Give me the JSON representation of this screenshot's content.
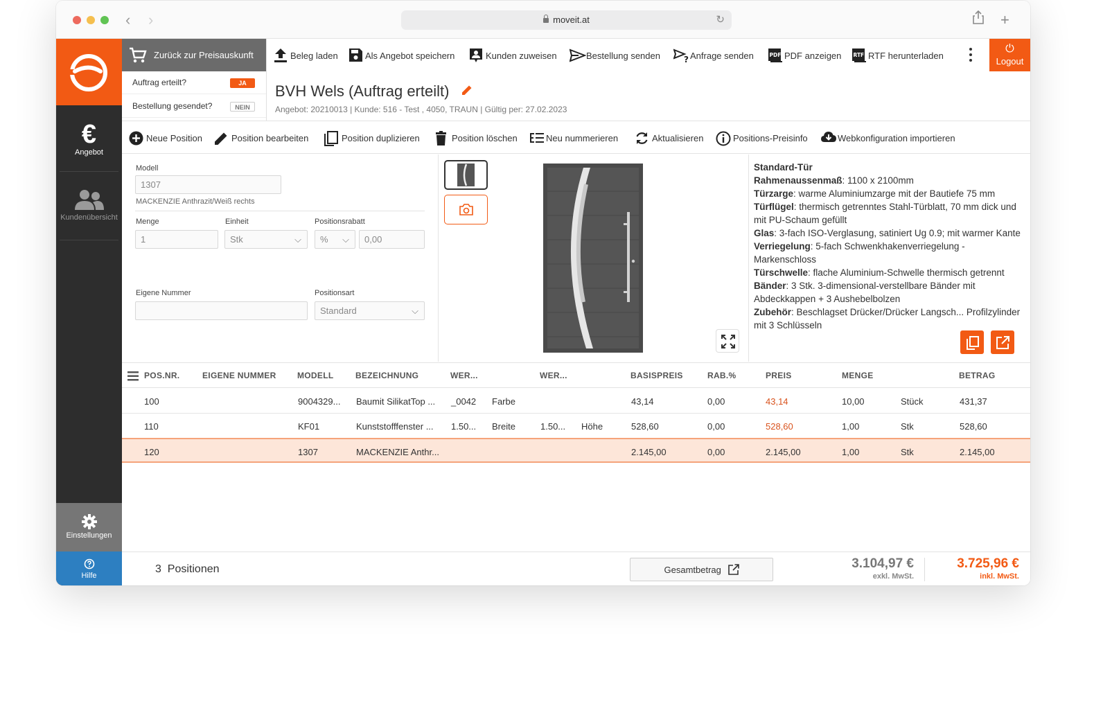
{
  "browser": {
    "url": "moveit.at"
  },
  "sidebar": {
    "items": [
      {
        "label": "Angebot",
        "icon": "euro-icon"
      },
      {
        "label": "Kundenübersicht",
        "icon": "users-icon"
      }
    ],
    "settings_label": "Einstellungen",
    "help_label": "Hilfe"
  },
  "header": {
    "back_label": "Zurück zur Preisauskunft",
    "status": [
      {
        "label": "Auftrag erteilt?",
        "badge": "JA"
      },
      {
        "label": "Bestellung gesendet?",
        "badge": "NEIN"
      }
    ],
    "toolbar": [
      {
        "label": "Beleg laden",
        "icon": "upload-icon"
      },
      {
        "label": "Als Angebot speichern",
        "icon": "save-icon"
      },
      {
        "label": "Kunden zuweisen",
        "icon": "assign-customer-icon"
      },
      {
        "label": "Bestellung senden",
        "icon": "send-icon"
      },
      {
        "label": "Anfrage senden",
        "icon": "send-request-icon"
      },
      {
        "label": "PDF anzeigen",
        "icon": "pdf-icon"
      },
      {
        "label": "RTF herunterladen",
        "icon": "rtf-icon"
      }
    ],
    "logout_label": "Logout",
    "title": "BVH Wels (Auftrag erteilt)",
    "subtitle": "Angebot: 20210013 | Kunde: 516 - Test , 4050, TRAUN | Gültig per: 27.02.2023"
  },
  "actions": [
    {
      "label": "Neue Position",
      "icon": "plus-circle-icon"
    },
    {
      "label": "Position bearbeiten",
      "icon": "pencil-icon"
    },
    {
      "label": "Position duplizieren",
      "icon": "duplicate-icon"
    },
    {
      "label": "Position löschen",
      "icon": "trash-icon"
    },
    {
      "label": "Neu nummerieren",
      "icon": "renumber-icon"
    },
    {
      "label": "Aktualisieren",
      "icon": "refresh-icon"
    },
    {
      "label": "Positions-Preisinfo",
      "icon": "info-icon"
    },
    {
      "label": "Webkonfiguration importieren",
      "icon": "cloud-download-icon"
    }
  ],
  "form": {
    "modell_label": "Modell",
    "modell_value": "1307",
    "modell_desc": "MACKENZIE Anthrazit/Weiß rechts",
    "menge_label": "Menge",
    "menge_value": "1",
    "einheit_label": "Einheit",
    "einheit_value": "Stk",
    "rabatt_label": "Positionsrabatt",
    "rabatt_unit": "%",
    "rabatt_value": "0,00",
    "eigene_label": "Eigene Nummer",
    "eigene_value": "",
    "art_label": "Positionsart",
    "art_value": "Standard"
  },
  "description": [
    {
      "title": "Standard-Tür",
      "text": ""
    },
    {
      "title": "Rahmenaussenmaß",
      "text": ": 1100 x 2100mm"
    },
    {
      "title": "Türzarge",
      "text": ": warme Aluminiumzarge mit der Bautiefe 75 mm"
    },
    {
      "title": "Türflügel",
      "text": ": thermisch getrenntes Stahl-Türblatt, 70 mm dick und mit PU-Schaum gefüllt"
    },
    {
      "title": "Glas",
      "text": ": 3-fach ISO-Verglasung, satiniert Ug 0.9; mit warmer Kante"
    },
    {
      "title": "Verriegelung",
      "text": ": 5-fach Schwenkhakenverriegelung - Markenschloss"
    },
    {
      "title": "Türschwelle",
      "text": ": flache Aluminium-Schwelle thermisch getrennt"
    },
    {
      "title": "Bänder",
      "text": ": 3 Stk. 3-dimensional-verstellbare Bänder mit Abdeckkappen + 3 Aushebelbolzen"
    },
    {
      "title": "Zubehör",
      "text": ": Beschlagset Drücker/Drücker Langsch... Profilzylinder mit 3 Schlüsseln"
    }
  ],
  "table": {
    "headers": [
      "POS.NR.",
      "EIGENE NUMMER",
      "MODELL",
      "BEZEICHNUNG",
      "WER...",
      "WER...",
      "BASISPREIS",
      "RAB.%",
      "PREIS",
      "MENGE",
      "BETRAG"
    ],
    "rows": [
      {
        "pos": "100",
        "eigene": "",
        "modell": "9004329...",
        "bez": "Baumit SilikatTop ...",
        "w1": "_0042",
        "w1l": "Farbe",
        "w2": "",
        "w2l": "",
        "basis": "43,14",
        "rab": "0,00",
        "preis": "43,14",
        "menge": "10,00",
        "einheit": "Stück",
        "betrag": "431,37"
      },
      {
        "pos": "110",
        "eigene": "",
        "modell": "KF01",
        "bez": "Kunststofffenster ...",
        "w1": "1.50...",
        "w1l": "Breite",
        "w2": "1.50...",
        "w2l": "Höhe",
        "basis": "528,60",
        "rab": "0,00",
        "preis": "528,60",
        "menge": "1,00",
        "einheit": "Stk",
        "betrag": "528,60"
      },
      {
        "pos": "120",
        "eigene": "",
        "modell": "1307",
        "bez": "MACKENZIE Anthr...",
        "w1": "",
        "w1l": "",
        "w2": "",
        "w2l": "",
        "basis": "2.145,00",
        "rab": "0,00",
        "preis": "2.145,00",
        "menge": "1,00",
        "einheit": "Stk",
        "betrag": "2.145,00"
      }
    ]
  },
  "footer": {
    "count": "3",
    "count_label": "Positionen",
    "gesamt_label": "Gesamtbetrag",
    "netto": "3.104,97 €",
    "netto_label": "exkl. MwSt.",
    "brutto": "3.725,96 €",
    "brutto_label": "inkl. MwSt."
  },
  "colors": {
    "accent": "#f25a14",
    "sidebar": "#2d2d2d",
    "help": "#2d7fc1",
    "selected_row": "#fde6d9"
  }
}
